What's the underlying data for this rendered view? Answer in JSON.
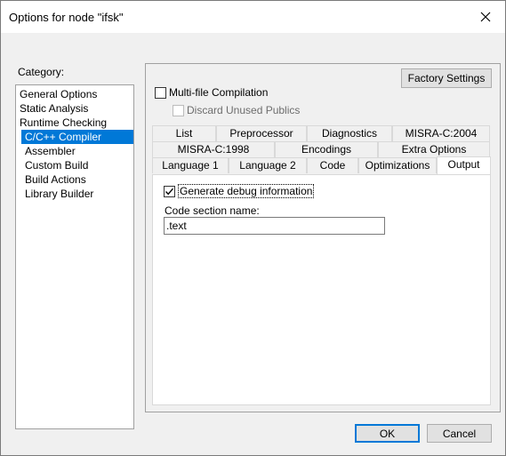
{
  "window": {
    "title": "Options for node \"ifsk\"",
    "close_icon": "close-icon"
  },
  "category": {
    "label": "Category:",
    "items": [
      {
        "label": "General Options",
        "selected": false,
        "indent": false
      },
      {
        "label": "Static Analysis",
        "selected": false,
        "indent": false
      },
      {
        "label": "Runtime Checking",
        "selected": false,
        "indent": false
      },
      {
        "label": "C/C++ Compiler",
        "selected": true,
        "indent": true
      },
      {
        "label": "Assembler",
        "selected": false,
        "indent": true
      },
      {
        "label": "Custom Build",
        "selected": false,
        "indent": true
      },
      {
        "label": "Build Actions",
        "selected": false,
        "indent": true
      },
      {
        "label": "Library Builder",
        "selected": false,
        "indent": true
      }
    ]
  },
  "factory_settings_label": "Factory Settings",
  "multifile": {
    "label": "Multi-file Compilation",
    "checked": false,
    "discard_label": "Discard Unused Publics",
    "discard_checked": false,
    "discard_disabled": true
  },
  "tabs": {
    "row1": [
      "List",
      "Preprocessor",
      "Diagnostics",
      "MISRA-C:2004"
    ],
    "row2": [
      "MISRA-C:1998",
      "Encodings",
      "Extra Options"
    ],
    "row3": [
      "Language 1",
      "Language 2",
      "Code",
      "Optimizations",
      "Output"
    ],
    "active": "Output"
  },
  "output": {
    "debug_label": "Generate debug information",
    "debug_checked": true,
    "code_section_label": "Code section name:",
    "code_section_value": ".text"
  },
  "buttons": {
    "ok": "OK",
    "cancel": "Cancel"
  }
}
